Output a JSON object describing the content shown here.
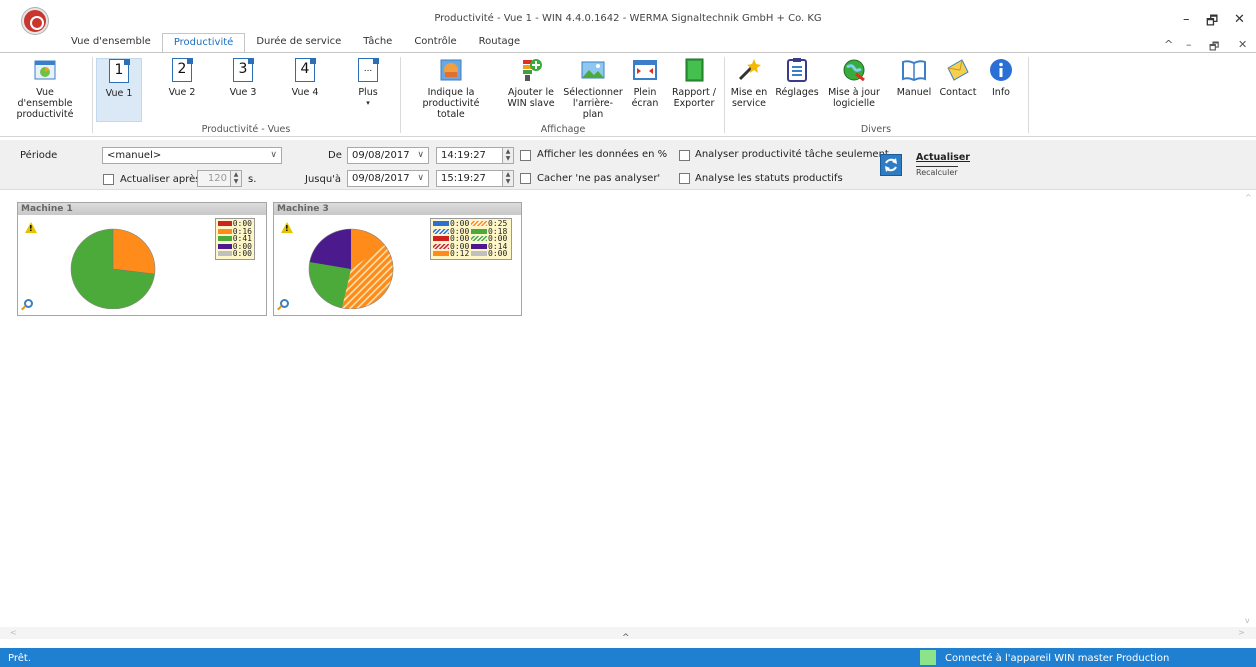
{
  "window": {
    "title": "Productivité - Vue 1 - WIN 4.4.0.1642 - WERMA Signaltechnik GmbH + Co. KG",
    "controls": {
      "minimize": "–",
      "restore": "🗗",
      "close": "✕",
      "collapse_ribbon": "^",
      "child_minimize": "–",
      "child_restore": "🗗",
      "child_close": "✕"
    }
  },
  "tabs": [
    "Vue d'ensemble",
    "Productivité",
    "Durée de service",
    "Tâche",
    "Contrôle",
    "Routage"
  ],
  "active_tab": "Productivité",
  "ribbon": {
    "overview": "Vue d'ensemble productivité",
    "views": [
      {
        "num": "1",
        "label": "Vue 1"
      },
      {
        "num": "2",
        "label": "Vue 2"
      },
      {
        "num": "3",
        "label": "Vue 3"
      },
      {
        "num": "4",
        "label": "Vue 4"
      }
    ],
    "plus": {
      "icon": "...",
      "label": "Plus"
    },
    "group_views": "Productivité - Vues",
    "indique": "Indique la productivité totale",
    "ajouter": "Ajouter le WIN slave",
    "selectionner": "Sélectionner l'arrière-plan",
    "plein": "Plein écran",
    "rapport": "Rapport / Exporter",
    "group_affichage": "Affichage",
    "mise_service": "Mise en service",
    "reglages": "Réglages",
    "mise_jour": "Mise à jour logicielle",
    "manuel": "Manuel",
    "contact": "Contact",
    "info": "Info",
    "group_divers": "Divers"
  },
  "filter": {
    "periode_label": "Période",
    "periode_value": "<manuel>",
    "actualiser_apres": "Actualiser après",
    "interval_value": "120",
    "interval_unit": "s.",
    "de_label": "De",
    "de_date": "09/08/2017",
    "de_time": "14:19:27",
    "jusqua_label": "Jusqu'à",
    "jusqua_date": "09/08/2017",
    "jusqua_time": "15:19:27",
    "afficher_pct": "Afficher les données en %",
    "cacher": "Cacher 'ne pas analyser'",
    "analyser_tache": "Analyser productivité tâche seulement",
    "analyse_statuts": "Analyse les statuts productifs",
    "actualiser": "Actualiser",
    "recalculer": "Recalculer"
  },
  "machines": [
    {
      "name": "Machine 1",
      "legend": [
        {
          "color": "#cc2222",
          "value": "0:00"
        },
        {
          "color": "#ff8c1a",
          "value": "0:16"
        },
        {
          "color": "#4caa3a",
          "value": "0:41"
        },
        {
          "color": "#4b1a8c",
          "value": "0:00"
        },
        {
          "color": "#c0c0c0",
          "value": "0:00"
        }
      ]
    },
    {
      "name": "Machine 3",
      "legend_left": [
        {
          "color": "#2a6fd6",
          "value": "0:00",
          "hatch": false
        },
        {
          "color": "#2a6fd6",
          "value": "0:00",
          "hatch": true
        },
        {
          "color": "#cc2222",
          "value": "0:00",
          "hatch": false
        },
        {
          "color": "#cc2222",
          "value": "0:00",
          "hatch": true
        },
        {
          "color": "#ff8c1a",
          "value": "0:12",
          "hatch": false
        }
      ],
      "legend_right": [
        {
          "color": "#ff8c1a",
          "value": "0:25",
          "hatch": true
        },
        {
          "color": "#4caa3a",
          "value": "0:18",
          "hatch": false
        },
        {
          "color": "#4caa3a",
          "value": "0:00",
          "hatch": true
        },
        {
          "color": "#4b1a8c",
          "value": "0:14",
          "hatch": false
        },
        {
          "color": "#c0c0c0",
          "value": "0:00",
          "hatch": false
        }
      ]
    }
  ],
  "status": {
    "text": "Prêt.",
    "connection": "Connecté à l'appareil WIN master Production"
  },
  "icons": {
    "warning": "warning-icon",
    "zoom": "magnifier-icon",
    "collapse_pane": "^",
    "scroll_up": "^",
    "scroll_down": "v",
    "scroll_left": "<",
    "scroll_right": ">",
    "dropdown": "∨",
    "exclamation": "!"
  },
  "colors": {
    "accent": "#1f7fd0",
    "orange": "#ff8c1a",
    "green": "#4caa3a",
    "purple": "#4b1a8c"
  }
}
